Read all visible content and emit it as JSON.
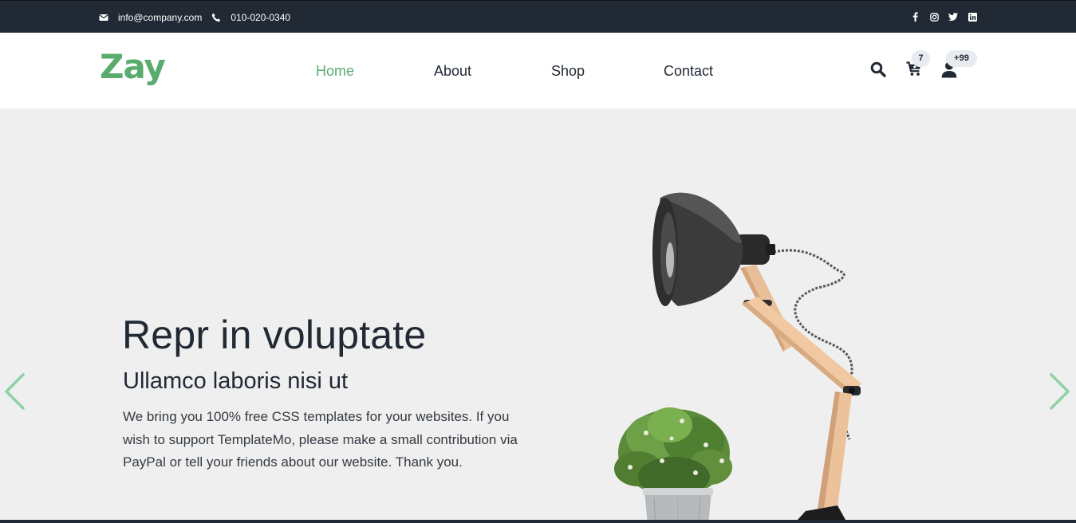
{
  "topbar": {
    "email": "info@company.com",
    "phone": "010-020-0340",
    "social": [
      "facebook-icon",
      "instagram-icon",
      "twitter-icon",
      "linkedin-icon"
    ]
  },
  "navbar": {
    "logo": "Zay",
    "links": [
      {
        "label": "Home",
        "active": true
      },
      {
        "label": "About",
        "active": false
      },
      {
        "label": "Shop",
        "active": false
      },
      {
        "label": "Contact",
        "active": false
      }
    ],
    "cart_count": "7",
    "user_count": "+99"
  },
  "hero": {
    "title": "Repr in voluptate",
    "subtitle": "Ullamco laboris nisi ut",
    "text": "We bring you 100% free CSS templates for your websites. If you wish to support TemplateMo, please make a small contribution via PayPal or tell your friends about our website. Thank you."
  },
  "colors": {
    "brand": "#59ab6e",
    "dark": "#212934",
    "hero_bg": "#efefef"
  }
}
